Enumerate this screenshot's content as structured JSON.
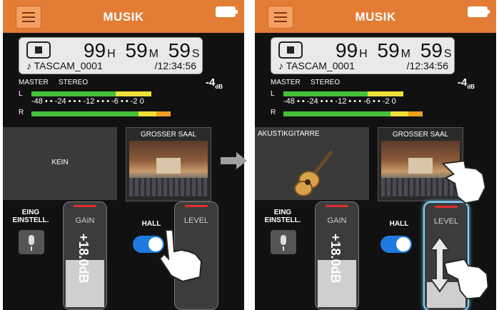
{
  "screens": [
    {
      "title": "MUSIK",
      "timecode": {
        "h": "99",
        "h_unit": "H",
        "m": "59",
        "m_unit": "M",
        "s": "59",
        "s_unit": "S"
      },
      "file_name": "♪ TASCAM_0001",
      "remaining": "/12:34:56",
      "meter": {
        "master": "MASTER",
        "mode": "STEREO",
        "level": "-4",
        "level_unit": "dB",
        "ch_l": "L",
        "ch_r": "R",
        "scale": "-48 • • -24 • • • -12 • • • -6 • • -2 0"
      },
      "left_panel_label": "KEIN",
      "right_panel_label": "GROSSER SAAL",
      "input_label_line1": "EING",
      "input_label_line2": "EINSTELL.",
      "gain_label": "GAIN",
      "gain_value": "+18.0dB",
      "hall_label": "HALL",
      "level_label": "LEVEL"
    },
    {
      "title": "MUSIK",
      "timecode": {
        "h": "99",
        "h_unit": "H",
        "m": "59",
        "m_unit": "M",
        "s": "59",
        "s_unit": "S"
      },
      "file_name": "♪ TASCAM_0001",
      "remaining": "/12:34:56",
      "meter": {
        "master": "MASTER",
        "mode": "STEREO",
        "level": "-4",
        "level_unit": "dB",
        "ch_l": "L",
        "ch_r": "R",
        "scale": "-48 • • -24 • • • -12 • • • -6 • • -2 0"
      },
      "left_panel_label": "AKUSTIKGITARRE",
      "right_panel_label": "GROSSER SAAL",
      "input_label_line1": "EING",
      "input_label_line2": "EINSTELL.",
      "gain_label": "GAIN",
      "gain_value": "+18.0dB",
      "hall_label": "HALL",
      "level_label": "LEVEL"
    }
  ],
  "colors": {
    "accent": "#e37d35",
    "toggle": "#1f7ae0",
    "meter_green": "#45c13a",
    "meter_yellow": "#f0e03a",
    "meter_orange": "#f0a020"
  },
  "icons": [
    "menu-icon",
    "battery-icon",
    "stop-icon",
    "mic-icon",
    "hand-pointer-icon",
    "arrow-right-icon",
    "up-down-arrow-icon"
  ]
}
